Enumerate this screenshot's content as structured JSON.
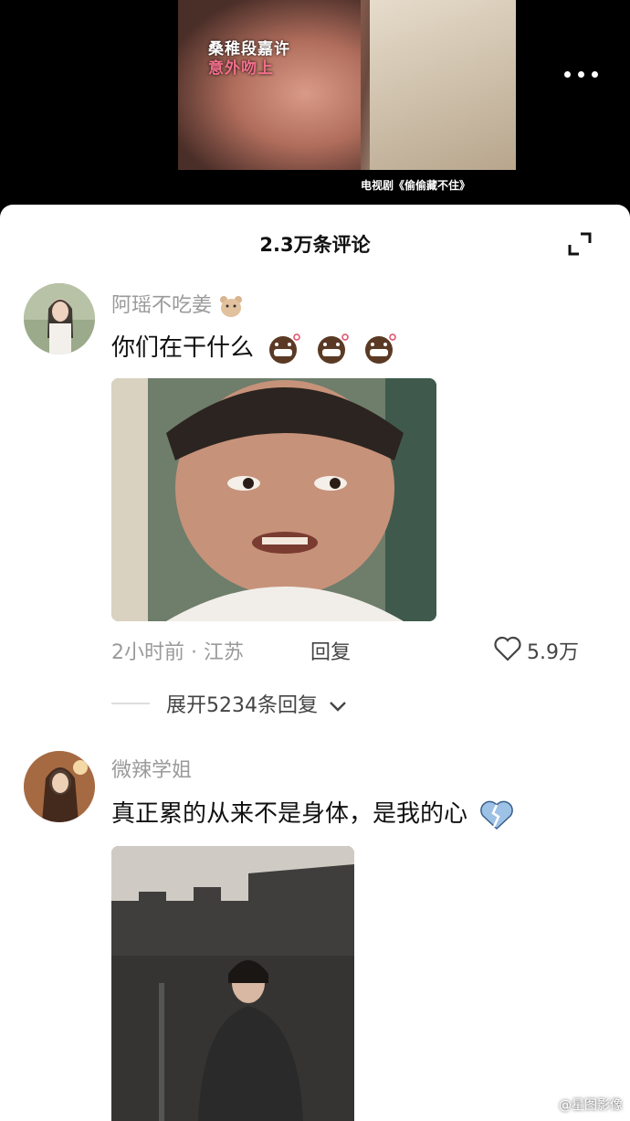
{
  "video": {
    "caption_line1": "桑稚段嘉许",
    "caption_line2": "意外吻上",
    "credit": "电视剧《偷偷藏不住》"
  },
  "comments_sheet": {
    "title": "2.3万条评论"
  },
  "comments": [
    {
      "username": "阿瑶不吃姜",
      "text": "你们在干什么",
      "time_location": "2小时前 · 江苏",
      "reply_label": "回复",
      "likes": "5.9万",
      "expand_label": "展开5234条回复"
    },
    {
      "username": "微辣学姐",
      "text": "真正累的从来不是身体，是我的心"
    }
  ],
  "watermark": "@星图影像",
  "colors": {
    "accent_pink": "#f06f8a",
    "muted_text": "#9a9a9a"
  }
}
